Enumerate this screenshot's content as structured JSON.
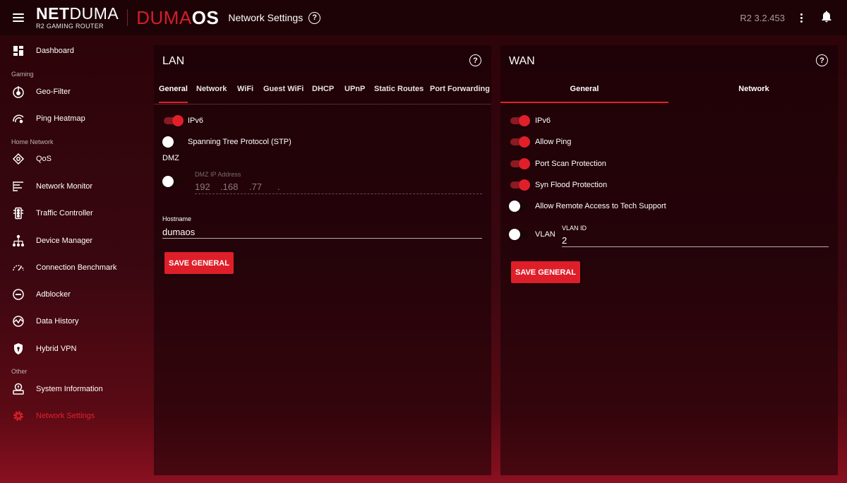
{
  "topbar": {
    "brand_bold": "NET",
    "brand_light": "DUMA",
    "brand_sub": "R2 GAMING ROUTER",
    "os_part1": "DUMA",
    "os_part2": "OS",
    "title": "Network Settings",
    "help": "?",
    "version": "R2 3.2.453"
  },
  "sidebar": {
    "dashboard": "Dashboard",
    "section_gaming": "Gaming",
    "geo_filter": "Geo-Filter",
    "ping_heatmap": "Ping Heatmap",
    "section_home": "Home Network",
    "qos": "QoS",
    "network_monitor": "Network Monitor",
    "traffic_controller": "Traffic Controller",
    "device_manager": "Device Manager",
    "connection_benchmark": "Connection Benchmark",
    "adblocker": "Adblocker",
    "data_history": "Data History",
    "hybrid_vpn": "Hybrid VPN",
    "section_other": "Other",
    "system_information": "System Information",
    "network_settings": "Network Settings",
    "active_color": "#e0202c"
  },
  "lan": {
    "title": "LAN",
    "help": "?",
    "tabs": [
      "General",
      "Network",
      "WiFi",
      "Guest WiFi",
      "DHCP",
      "UPnP",
      "Static Routes",
      "Port Forwarding"
    ],
    "ipv6_label": "IPv6",
    "ipv6_on": true,
    "stp_label": "Spanning Tree Protocol (STP)",
    "stp_on": false,
    "dmz_heading": "DMZ",
    "dmz_on": false,
    "dmz_ip_label": "DMZ IP Address",
    "dmz_octets": [
      "192",
      ".168",
      ".77",
      "."
    ],
    "hostname_label": "Hostname",
    "hostname_value": "dumaos",
    "save_label": "SAVE GENERAL"
  },
  "wan": {
    "title": "WAN",
    "help": "?",
    "tabs": [
      "General",
      "Network"
    ],
    "ipv6_label": "IPv6",
    "ipv6_on": true,
    "allow_ping_label": "Allow Ping",
    "allow_ping_on": true,
    "port_scan_label": "Port Scan Protection",
    "port_scan_on": true,
    "syn_flood_label": "Syn Flood Protection",
    "syn_flood_on": true,
    "remote_access_label": "Allow Remote Access to Tech Support",
    "remote_access_on": false,
    "vlan_label": "VLAN",
    "vlan_on": false,
    "vlan_id_label": "VLAN ID",
    "vlan_id_value": "2",
    "save_label": "SAVE GENERAL"
  },
  "colors": {
    "accent": "#e0202c",
    "button": "#de1f2a"
  }
}
